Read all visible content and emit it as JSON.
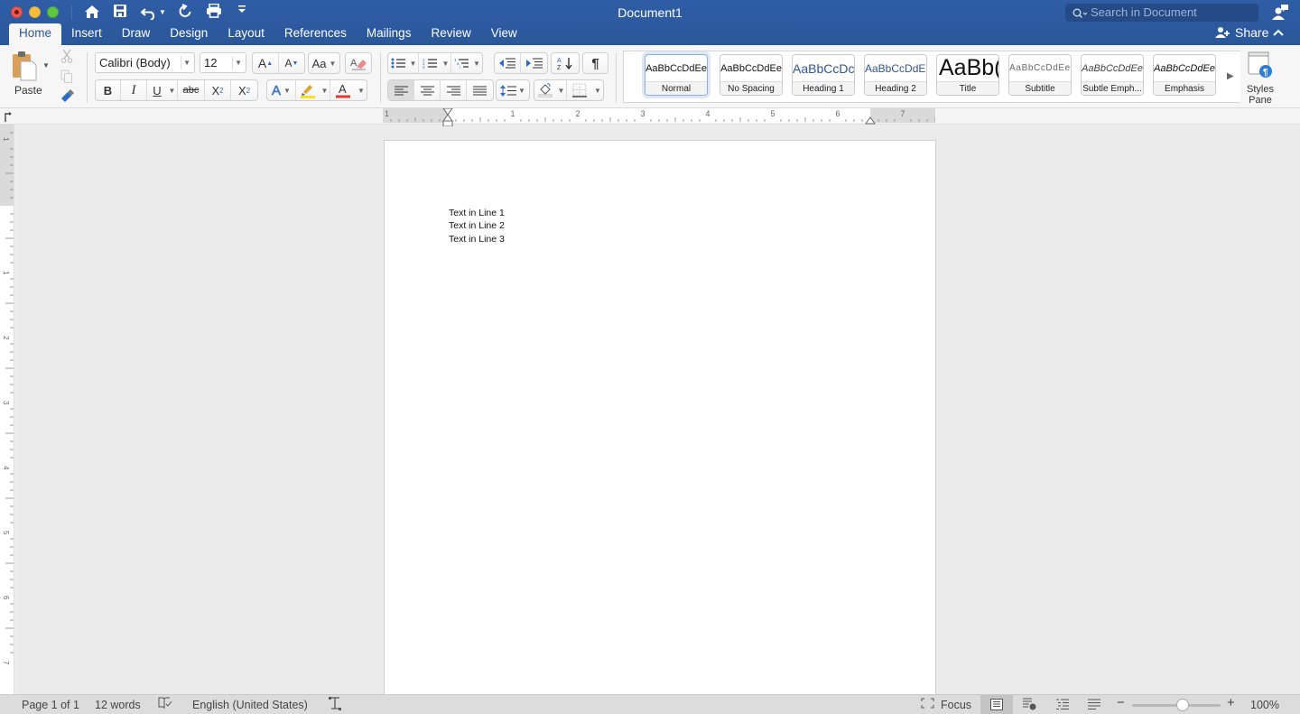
{
  "window": {
    "title": "Document1"
  },
  "quick_access": {
    "home": "home-icon",
    "save": "save-icon",
    "undo": "undo-icon",
    "redo": "redo-icon",
    "print": "print-icon",
    "customize": "customize-icon"
  },
  "search": {
    "placeholder": "Search in Document"
  },
  "tabs": [
    {
      "label": "Home",
      "active": true
    },
    {
      "label": "Insert"
    },
    {
      "label": "Draw"
    },
    {
      "label": "Design"
    },
    {
      "label": "Layout"
    },
    {
      "label": "References"
    },
    {
      "label": "Mailings"
    },
    {
      "label": "Review"
    },
    {
      "label": "View"
    }
  ],
  "share": {
    "label": "Share"
  },
  "ribbon": {
    "paste_label": "Paste",
    "font_name": "Calibri (Body)",
    "font_size": "12",
    "bold": "B",
    "italic": "I",
    "underline": "U",
    "strikethrough": "abc",
    "subscript": "X",
    "subscript_sub": "2",
    "superscript": "X",
    "superscript_sup": "2",
    "highlight_color": "#f5e21b",
    "font_color": "#e23a32",
    "styles_pane_label_1": "Styles",
    "styles_pane_label_2": "Pane",
    "styles": [
      {
        "preview": "AaBbCcDdEe",
        "label": "Normal",
        "selected": true
      },
      {
        "preview": "AaBbCcDdEe",
        "label": "No Spacing"
      },
      {
        "preview": "AaBbCcDc",
        "label": "Heading 1"
      },
      {
        "preview": "AaBbCcDdEe",
        "label": "Heading 2"
      },
      {
        "preview": "AaBb(",
        "label": "Title"
      },
      {
        "preview": "AaBbCcDdEe",
        "label": "Subtitle"
      },
      {
        "preview": "AaBbCcDdEe",
        "label": "Subtle Emph..."
      },
      {
        "preview": "AaBbCcDdEe",
        "label": "Emphasis"
      }
    ]
  },
  "ruler": {
    "h_numbers": [
      "1",
      "1",
      "2",
      "3",
      "4",
      "5",
      "6",
      "7"
    ],
    "v_numbers": [
      "1",
      "1",
      "2",
      "3",
      "4",
      "5",
      "6",
      "7"
    ]
  },
  "document": {
    "lines": [
      "Text in Line 1",
      "Text in Line 2",
      "Text in Line 3"
    ]
  },
  "status": {
    "page": "Page 1 of 1",
    "words": "12 words",
    "language": "English (United States)",
    "focus": "Focus",
    "zoom_minus": "−",
    "zoom_plus": "+",
    "zoom_level": "100%",
    "zoom_fraction": 0.5
  },
  "colors": {
    "accent": "#2b579a"
  }
}
